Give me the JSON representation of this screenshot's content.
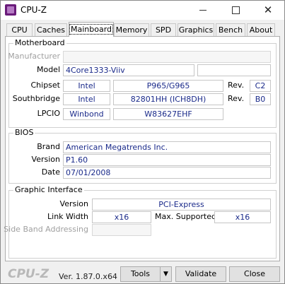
{
  "window": {
    "title": "CPU-Z"
  },
  "tabs": [
    "CPU",
    "Caches",
    "Mainboard",
    "Memory",
    "SPD",
    "Graphics",
    "Bench",
    "About"
  ],
  "active_tab": "Mainboard",
  "motherboard": {
    "title": "Motherboard",
    "manufacturer_label": "Manufacturer",
    "manufacturer": "",
    "model_label": "Model",
    "model": "4Core1333-Viiv",
    "model_extra": "",
    "chipset_label": "Chipset",
    "chipset_vendor": "Intel",
    "chipset_model": "P965/G965",
    "chipset_rev_label": "Rev.",
    "chipset_rev": "C2",
    "southbridge_label": "Southbridge",
    "southbridge_vendor": "Intel",
    "southbridge_model": "82801HH (ICH8DH)",
    "southbridge_rev_label": "Rev.",
    "southbridge_rev": "B0",
    "lpcio_label": "LPCIO",
    "lpcio_vendor": "Winbond",
    "lpcio_model": "W83627EHF"
  },
  "bios": {
    "title": "BIOS",
    "brand_label": "Brand",
    "brand": "American Megatrends Inc.",
    "version_label": "Version",
    "version": "P1.60",
    "date_label": "Date",
    "date": "07/01/2008"
  },
  "graphic_interface": {
    "title": "Graphic Interface",
    "version_label": "Version",
    "version": "PCI-Express",
    "link_width_label": "Link Width",
    "link_width": "x16",
    "max_supported_label": "Max. Supported",
    "max_supported": "x16",
    "side_band_label": "Side Band Addressing",
    "side_band": ""
  },
  "footer": {
    "logo": "CPU-Z",
    "version": "Ver. 1.87.0.x64",
    "tools_label": "Tools",
    "validate_label": "Validate",
    "close_label": "Close"
  },
  "icons": {
    "minimize": "minimize-icon",
    "maximize": "maximize-icon",
    "close": "close-icon",
    "dropdown": "chevron-down-icon"
  }
}
